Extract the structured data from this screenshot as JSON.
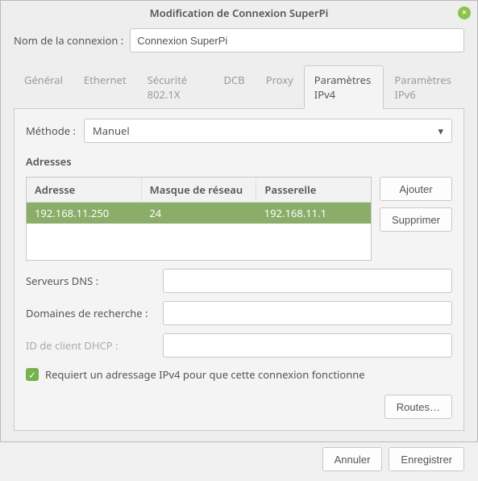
{
  "window": {
    "title": "Modification de Connexion SuperPi"
  },
  "connection": {
    "name_label": "Nom de la connexion :",
    "name_value": "Connexion SuperPi"
  },
  "tabs": {
    "general": "Général",
    "ethernet": "Ethernet",
    "security": "Sécurité 802.1X",
    "dcb": "DCB",
    "proxy": "Proxy",
    "ipv4": "Paramètres IPv4",
    "ipv6": "Paramètres IPv6"
  },
  "ipv4": {
    "method_label": "Méthode :",
    "method_value": "Manuel",
    "addresses_header": "Adresses",
    "columns": {
      "address": "Adresse",
      "netmask": "Masque de réseau",
      "gateway": "Passerelle"
    },
    "rows": [
      {
        "address": "192.168.11.250",
        "netmask": "24",
        "gateway": "192.168.11.1"
      }
    ],
    "add_label": "Ajouter",
    "delete_label": "Supprimer",
    "dns_label": "Serveurs DNS :",
    "dns_value": "",
    "search_label": "Domaines de recherche :",
    "search_value": "",
    "dhcp_label": "ID de client DHCP :",
    "dhcp_value": "",
    "require_label": "Requiert un adressage IPv4 pour que cette connexion fonctionne",
    "routes_label": "Routes…"
  },
  "buttons": {
    "cancel": "Annuler",
    "save": "Enregistrer"
  }
}
